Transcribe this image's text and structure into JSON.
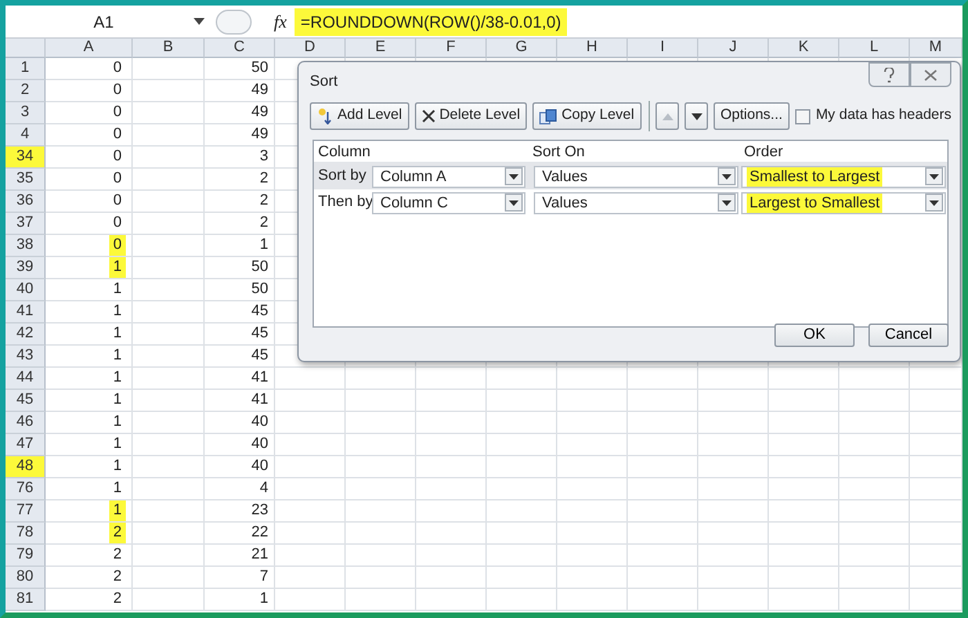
{
  "formula_bar": {
    "name_box": "A1",
    "function_label": "fx",
    "formula": "=ROUNDDOWN(ROW()/38-0.01,0)",
    "highlighted": true
  },
  "columns": [
    "A",
    "B",
    "C",
    "D",
    "E",
    "F",
    "G",
    "H",
    "I",
    "J",
    "K",
    "L",
    "M"
  ],
  "rows": [
    {
      "header": "1",
      "a": "0",
      "c": "50",
      "header_highlighted": false,
      "a_highlighted": false
    },
    {
      "header": "2",
      "a": "0",
      "c": "49",
      "header_highlighted": false,
      "a_highlighted": false
    },
    {
      "header": "3",
      "a": "0",
      "c": "49",
      "header_highlighted": false,
      "a_highlighted": false
    },
    {
      "header": "4",
      "a": "0",
      "c": "49",
      "header_highlighted": false,
      "a_highlighted": false
    },
    {
      "header": "34",
      "a": "0",
      "c": "3",
      "header_highlighted": true,
      "a_highlighted": false
    },
    {
      "header": "35",
      "a": "0",
      "c": "2",
      "header_highlighted": false,
      "a_highlighted": false
    },
    {
      "header": "36",
      "a": "0",
      "c": "2",
      "header_highlighted": false,
      "a_highlighted": false
    },
    {
      "header": "37",
      "a": "0",
      "c": "2",
      "header_highlighted": false,
      "a_highlighted": false
    },
    {
      "header": "38",
      "a": "0",
      "c": "1",
      "header_highlighted": false,
      "a_highlighted": true
    },
    {
      "header": "39",
      "a": "1",
      "c": "50",
      "header_highlighted": false,
      "a_highlighted": true
    },
    {
      "header": "40",
      "a": "1",
      "c": "50",
      "header_highlighted": false,
      "a_highlighted": false
    },
    {
      "header": "41",
      "a": "1",
      "c": "45",
      "header_highlighted": false,
      "a_highlighted": false
    },
    {
      "header": "42",
      "a": "1",
      "c": "45",
      "header_highlighted": false,
      "a_highlighted": false
    },
    {
      "header": "43",
      "a": "1",
      "c": "45",
      "header_highlighted": false,
      "a_highlighted": false
    },
    {
      "header": "44",
      "a": "1",
      "c": "41",
      "header_highlighted": false,
      "a_highlighted": false
    },
    {
      "header": "45",
      "a": "1",
      "c": "41",
      "header_highlighted": false,
      "a_highlighted": false
    },
    {
      "header": "46",
      "a": "1",
      "c": "40",
      "header_highlighted": false,
      "a_highlighted": false
    },
    {
      "header": "47",
      "a": "1",
      "c": "40",
      "header_highlighted": false,
      "a_highlighted": false
    },
    {
      "header": "48",
      "a": "1",
      "c": "40",
      "header_highlighted": true,
      "a_highlighted": false
    },
    {
      "header": "76",
      "a": "1",
      "c": "4",
      "header_highlighted": false,
      "a_highlighted": false
    },
    {
      "header": "77",
      "a": "1",
      "c": "23",
      "header_highlighted": false,
      "a_highlighted": true
    },
    {
      "header": "78",
      "a": "2",
      "c": "22",
      "header_highlighted": false,
      "a_highlighted": true
    },
    {
      "header": "79",
      "a": "2",
      "c": "21",
      "header_highlighted": false,
      "a_highlighted": false
    },
    {
      "header": "80",
      "a": "2",
      "c": "7",
      "header_highlighted": false,
      "a_highlighted": false
    },
    {
      "header": "81",
      "a": "2",
      "c": "1",
      "header_highlighted": false,
      "a_highlighted": false
    }
  ],
  "sort_dialog": {
    "title": "Sort",
    "toolbar": [
      {
        "kind": "add",
        "label": "Add Level",
        "disabled": false
      },
      {
        "kind": "delete",
        "label": "Delete Level",
        "disabled": false
      },
      {
        "kind": "copy",
        "label": "Copy Level",
        "disabled": false
      },
      {
        "kind": "up",
        "disabled": true
      },
      {
        "kind": "down",
        "disabled": false
      },
      {
        "kind": "text",
        "label": "Options...",
        "disabled": false
      }
    ],
    "headers_checkbox": {
      "label": "My data has headers",
      "checked": false
    },
    "level_columns": [
      "Column",
      "Sort On",
      "Order"
    ],
    "levels": [
      {
        "label": "Sort by",
        "column": "Column A",
        "sort_on": "Values",
        "order": "Smallest to Largest",
        "order_highlighted": true,
        "selected": true
      },
      {
        "label": "Then by",
        "column": "Column C",
        "sort_on": "Values",
        "order": "Largest to Smallest",
        "order_highlighted": true,
        "selected": false
      }
    ],
    "buttons": [
      "OK",
      "Cancel"
    ]
  }
}
